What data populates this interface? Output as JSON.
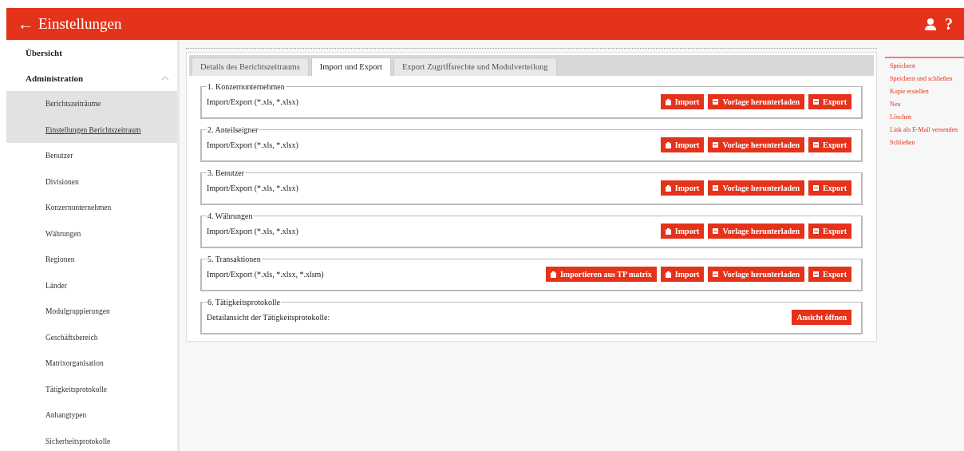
{
  "header": {
    "back": "←",
    "title": "Einstellungen",
    "help": "?"
  },
  "sidebar": {
    "items": [
      {
        "label": "Übersicht"
      },
      {
        "label": "Administration",
        "expanded": true,
        "children": [
          {
            "label": "Berichtszeiträume",
            "highlighted": true,
            "selected": false
          },
          {
            "label": "Einstellungen Berichtszeitraum",
            "highlighted": true,
            "selected": true
          },
          {
            "label": "Benutzer",
            "highlighted": false,
            "selected": false
          },
          {
            "label": "Divisionen",
            "highlighted": false,
            "selected": false
          },
          {
            "label": "Konzernunternehmen",
            "highlighted": false,
            "selected": false
          },
          {
            "label": "Währungen",
            "highlighted": false,
            "selected": false
          },
          {
            "label": "Regionen",
            "highlighted": false,
            "selected": false
          },
          {
            "label": "Länder",
            "highlighted": false,
            "selected": false
          },
          {
            "label": "Modulgruppierungen",
            "highlighted": false,
            "selected": false
          },
          {
            "label": "Geschäftsbereich",
            "highlighted": false,
            "selected": false
          },
          {
            "label": "Matrixorganisation",
            "highlighted": false,
            "selected": false
          },
          {
            "label": "Tätigkeitsprotokolle",
            "highlighted": false,
            "selected": false
          },
          {
            "label": "Anhangtypen",
            "highlighted": false,
            "selected": false
          },
          {
            "label": "Sicherheitsprotokolle",
            "highlighted": false,
            "selected": false
          }
        ]
      }
    ]
  },
  "tabs": [
    {
      "label": "Details des Berichtszeitraums",
      "selected": false
    },
    {
      "label": "Import und Export",
      "selected": true
    },
    {
      "label": "Export Zugriffsrechte und Modulverteilung",
      "selected": false
    }
  ],
  "sections": [
    {
      "legend": "1. Konzernunternehmen",
      "text": "Import/Export (*.xls, *.xlsx)",
      "buttons": [
        {
          "label": "Import",
          "kind": "upload"
        },
        {
          "label": "Vorlage herunterladen",
          "kind": "file"
        },
        {
          "label": "Export",
          "kind": "file"
        }
      ]
    },
    {
      "legend": "2. Anteilseigner",
      "text": "Import/Export (*.xls, *.xlsx)",
      "buttons": [
        {
          "label": "Import",
          "kind": "upload"
        },
        {
          "label": "Vorlage herunterladen",
          "kind": "file"
        },
        {
          "label": "Export",
          "kind": "file"
        }
      ]
    },
    {
      "legend": "3. Benutzer",
      "text": "Import/Export (*.xls, *.xlsx)",
      "buttons": [
        {
          "label": "Import",
          "kind": "upload"
        },
        {
          "label": "Vorlage herunterladen",
          "kind": "file"
        },
        {
          "label": "Export",
          "kind": "file"
        }
      ]
    },
    {
      "legend": "4. Währungen",
      "text": "Import/Export (*.xls, *.xlsx)",
      "buttons": [
        {
          "label": "Import",
          "kind": "upload"
        },
        {
          "label": "Vorlage herunterladen",
          "kind": "file"
        },
        {
          "label": "Export",
          "kind": "file"
        }
      ]
    },
    {
      "legend": "5. Transaktionen",
      "text": "Import/Export (*.xls, *.xlsx, *.xlsm)",
      "buttons": [
        {
          "label": "Importieren aus TP matrix",
          "kind": "upload"
        },
        {
          "label": "Import",
          "kind": "upload"
        },
        {
          "label": "Vorlage herunterladen",
          "kind": "file"
        },
        {
          "label": "Export",
          "kind": "file"
        }
      ]
    },
    {
      "legend": "6. Tätigkeitsprotokolle",
      "text": "Detailansicht der Tätigkeitsprotokolle:",
      "buttons": [
        {
          "label": "Ansicht öffnen",
          "kind": "plain"
        }
      ]
    }
  ],
  "actions": [
    "Speichern",
    "Speichern und schließen",
    "Kopie erstellen",
    "Neu",
    "Löschen",
    "Link als E-Mail versenden",
    "Schließen"
  ]
}
